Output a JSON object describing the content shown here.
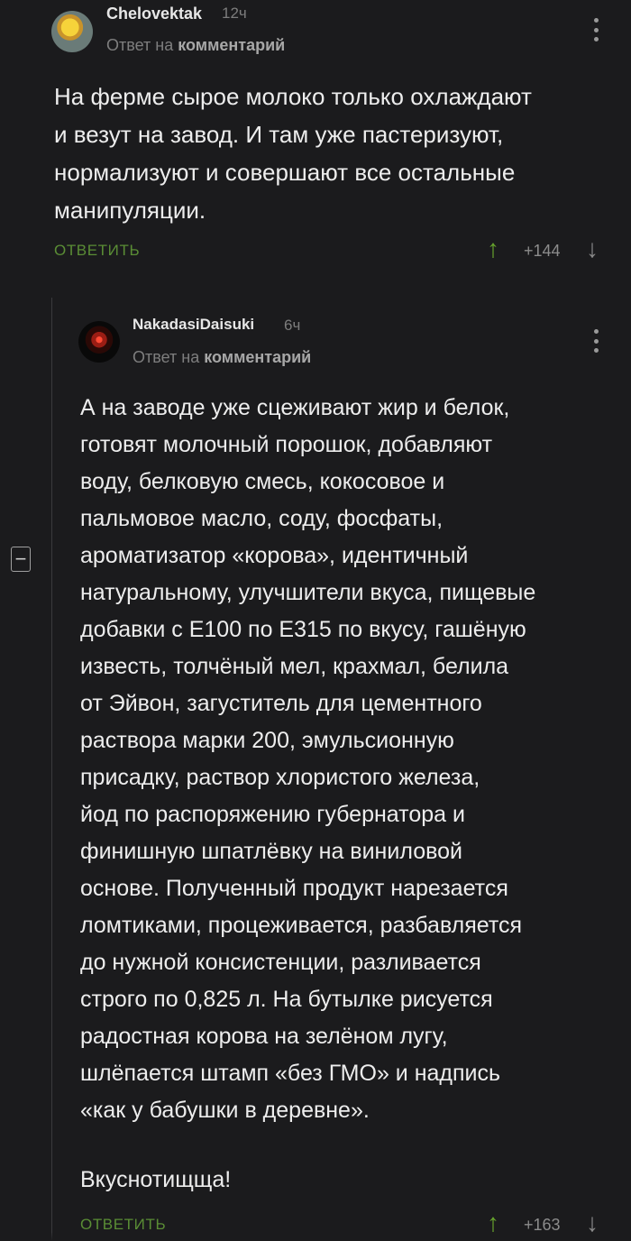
{
  "comments": [
    {
      "username": "Chelovektak",
      "time": "12ч",
      "reply_prefix": "Ответ на",
      "reply_target": "комментарий",
      "text": "На ферме сырое молоко только охлаждают\nи везут на завод. И там уже пастеризуют,\nнормализуют и совершают все остальные\nманипуляции.",
      "reply_label": "ОТВЕТИТЬ",
      "score": "+144",
      "avatar_icon": "duck-avatar"
    },
    {
      "username": "NakadasiDaisuki",
      "time": "6ч",
      "reply_prefix": "Ответ на",
      "reply_target": "комментарий",
      "text": "А на заводе уже сцеживают жир и белок,\nготовят молочный порошок, добавляют\nводу, белковую смесь, кокосовое и\nпальмовое масло, соду, фосфаты,\nароматизатор «корова», идентичный\nнатуральному, улучшители вкуса, пищевые\nдобавки с Е100 по Е315 по вкусу, гашёную\nизвесть, толчёный мел, крахмал, белила\nот Эйвон, загуститель для цементного\nраствора марки 200, эмульсионную\nприсадку, раствор хлористого железа,\nйод по распоряжению губернатора и\nфинишную шпатлёвку на виниловой\nоснове. Полученный продукт нарезается\nломтиками, процеживается, разбавляется\nдо нужной консистенции, разливается\nстрого по 0,825 л. На бутылке рисуется\nрадостная корова на зелёном лугу,\nшлёпается штамп «без ГМО» и надпись\n«как у бабушки в деревне».",
      "text_tail": "Вкуснотищща!",
      "reply_label": "ОТВЕТИТЬ",
      "score": "+163",
      "avatar_icon": "flower-avatar"
    }
  ],
  "icons": {
    "upvote": "↑",
    "downvote": "↓",
    "more": "more-vertical-icon",
    "collapse": "−"
  },
  "colors": {
    "background": "#1b1b1d",
    "accent": "#67a32d",
    "reply_link": "#5a8d35"
  }
}
